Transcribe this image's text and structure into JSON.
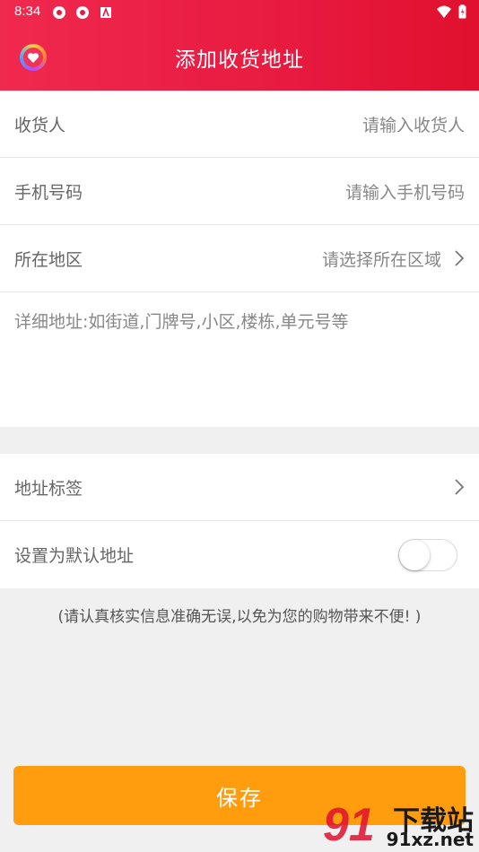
{
  "status_bar": {
    "time": "8:34"
  },
  "header": {
    "title": "添加收货地址",
    "logo_icon": "heart-icon"
  },
  "form": {
    "receiver": {
      "label": "收货人",
      "placeholder": "请输入收货人"
    },
    "phone": {
      "label": "手机号码",
      "placeholder": "请输入手机号码"
    },
    "region": {
      "label": "所在地区",
      "placeholder": "请选择所在区域"
    },
    "detail": {
      "placeholder": "详细地址:如街道,门牌号,小区,楼栋,单元号等"
    },
    "address_tag": {
      "label": "地址标签"
    },
    "default_address": {
      "label": "设置为默认地址",
      "enabled": false
    }
  },
  "notice": "(请认真核实信息准确无误,以免为您的购物带来不便! )",
  "save_button": {
    "label": "保存"
  },
  "watermark": {
    "logo": "91",
    "text_top": "下载站",
    "text_bottom": "91xz.net"
  },
  "colors": {
    "header_start": "#f0294f",
    "header_end": "#e0102e",
    "save_button": "#ff9d0f"
  }
}
